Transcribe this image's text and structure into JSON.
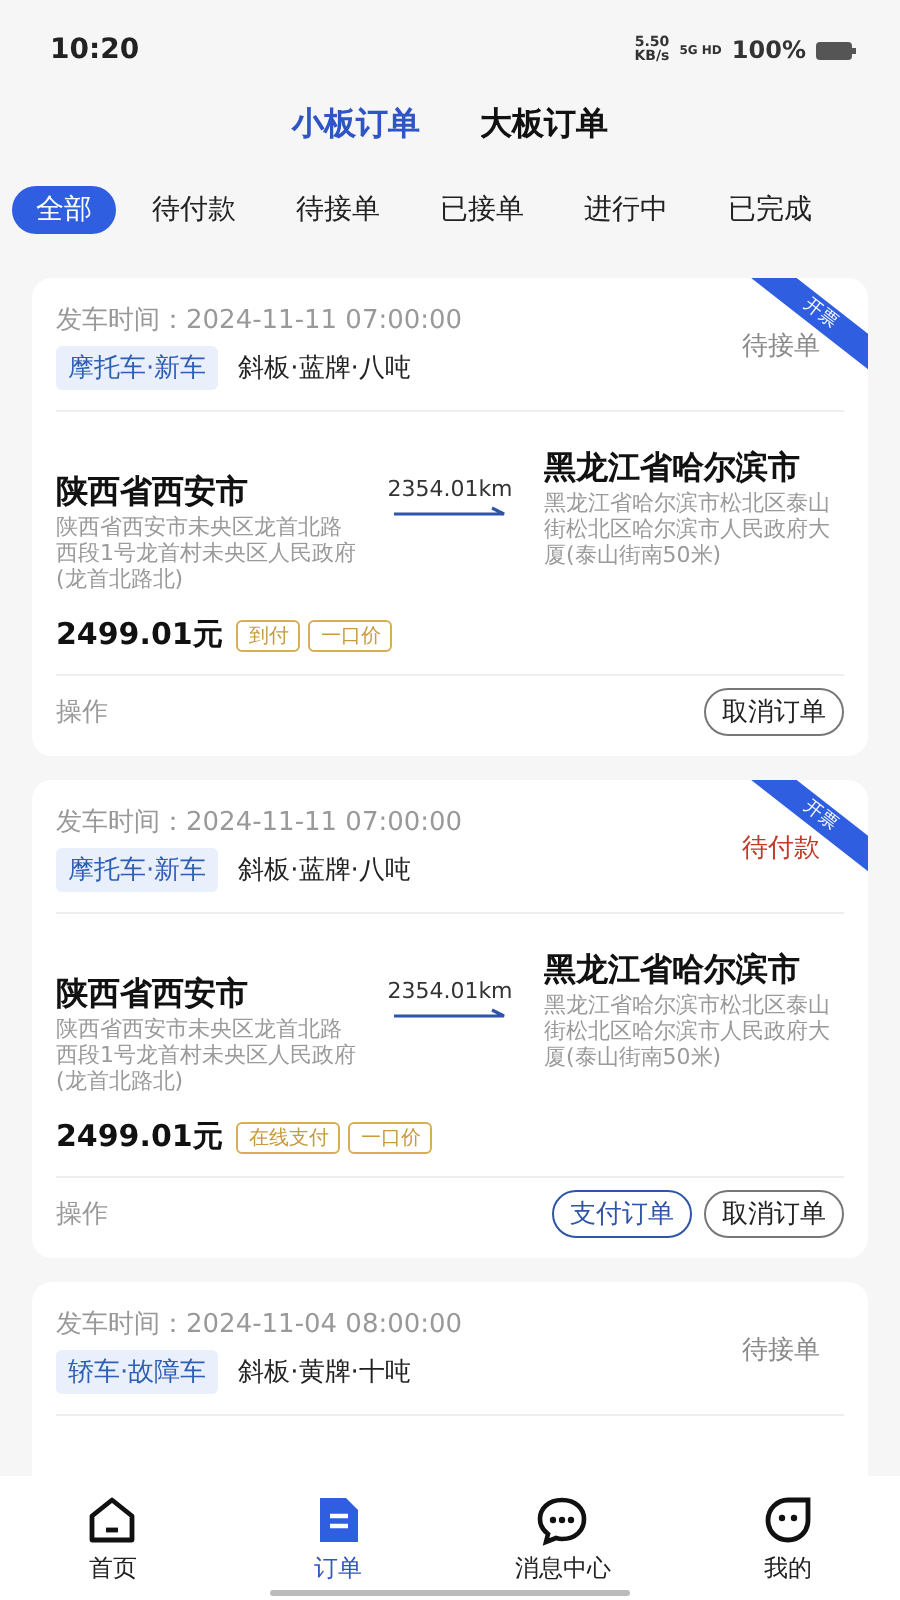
{
  "status_bar": {
    "time": "10:20",
    "net_speed": "5.50",
    "net_unit": "KB/s",
    "network": "5G HD",
    "battery": "100%"
  },
  "order_tabs": [
    {
      "label": "小板订单",
      "selected": true
    },
    {
      "label": "大板订单",
      "selected": false
    }
  ],
  "filters": [
    {
      "label": "全部",
      "selected": true
    },
    {
      "label": "待付款",
      "selected": false
    },
    {
      "label": "待接单",
      "selected": false
    },
    {
      "label": "已接单",
      "selected": false
    },
    {
      "label": "进行中",
      "selected": false
    },
    {
      "label": "已完成",
      "selected": false
    }
  ],
  "orders": [
    {
      "depart_label": "发车时间：",
      "depart_time": "2024-11-11 07:00:00",
      "vehicle_tag": "摩托车·新车",
      "vehicle_specs": "斜板·蓝牌·八吨",
      "status": "待接单",
      "color": "#8a8a8a",
      "ribbon": "开票",
      "origin": {
        "city": "陕西省西安市",
        "address": "陕西省西安市未央区龙首北路西段1号龙首村未央区人民政府(龙首北路北)"
      },
      "distance": "2354.01km",
      "destination": {
        "city": "黑龙江省哈尔滨市",
        "address": "黑龙江省哈尔滨市松北区泰山街松北区哈尔滨市人民政府大厦(泰山街南50米)"
      },
      "price": "2499.01元",
      "price_tags": [
        "到付",
        "一口价"
      ],
      "action_label": "操作",
      "actions": [
        {
          "label": "取消订单",
          "kind": "secondary"
        }
      ]
    },
    {
      "depart_label": "发车时间：",
      "depart_time": "2024-11-11 07:00:00",
      "vehicle_tag": "摩托车·新车",
      "vehicle_specs": "斜板·蓝牌·八吨",
      "status": "待付款",
      "color": "#c0392b",
      "ribbon": "开票",
      "origin": {
        "city": "陕西省西安市",
        "address": "陕西省西安市未央区龙首北路西段1号龙首村未央区人民政府(龙首北路北)"
      },
      "distance": "2354.01km",
      "destination": {
        "city": "黑龙江省哈尔滨市",
        "address": "黑龙江省哈尔滨市松北区泰山街松北区哈尔滨市人民政府大厦(泰山街南50米)"
      },
      "price": "2499.01元",
      "price_tags": [
        "在线支付",
        "一口价"
      ],
      "action_label": "操作",
      "actions": [
        {
          "label": "支付订单",
          "kind": "primary"
        },
        {
          "label": "取消订单",
          "kind": "secondary"
        }
      ]
    },
    {
      "depart_label": "发车时间：",
      "depart_time": "2024-11-04 08:00:00",
      "vehicle_tag": "轿车·故障车",
      "vehicle_specs": "斜板·黄牌·十吨",
      "status": "待接单",
      "color": "#8a8a8a"
    }
  ],
  "bottom_nav": [
    {
      "label": "首页",
      "kind": "home",
      "selected": false
    },
    {
      "label": "订单",
      "kind": "orders",
      "selected": true
    },
    {
      "label": "消息中心",
      "kind": "chat",
      "selected": false
    },
    {
      "label": "我的",
      "kind": "face",
      "selected": false
    }
  ]
}
